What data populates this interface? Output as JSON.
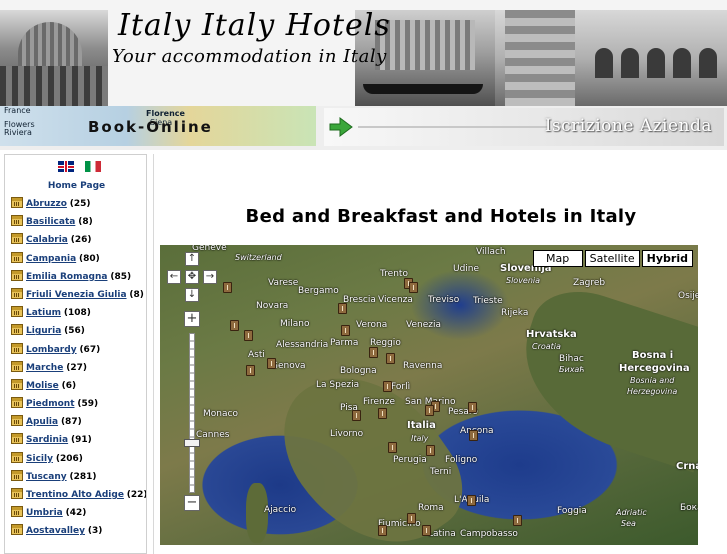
{
  "header": {
    "title": "Italy Italy Hotels",
    "subtitle": "Your accommodation in Italy"
  },
  "strip": {
    "book_online_label": "Book-Online",
    "book_online_places": [
      "France",
      "Florence",
      "Flowers",
      "Siena",
      "Riviera"
    ],
    "iscrizione_label": "Iscrizione Azienda"
  },
  "sidebar": {
    "home_label": "Home Page",
    "regions": [
      {
        "name": "Abruzzo",
        "count": "(25)"
      },
      {
        "name": "Basilicata",
        "count": "(8)"
      },
      {
        "name": "Calabria",
        "count": "(26)"
      },
      {
        "name": "Campania",
        "count": "(80)"
      },
      {
        "name": "Emilia Romagna",
        "count": "(85)"
      },
      {
        "name": "Friuli Venezia Giulia",
        "count": "(8)"
      },
      {
        "name": "Latium",
        "count": "(108)"
      },
      {
        "name": "Liguria",
        "count": "(56)"
      },
      {
        "name": "Lombardy",
        "count": "(67)"
      },
      {
        "name": "Marche",
        "count": "(27)"
      },
      {
        "name": "Molise",
        "count": "(6)"
      },
      {
        "name": "Piedmont",
        "count": "(59)"
      },
      {
        "name": "Apulia",
        "count": "(87)"
      },
      {
        "name": "Sardinia",
        "count": "(91)"
      },
      {
        "name": "Sicily",
        "count": "(206)"
      },
      {
        "name": "Tuscany",
        "count": "(281)"
      },
      {
        "name": "Trentino Alto Adige",
        "count": "(22)"
      },
      {
        "name": "Umbria",
        "count": "(42)"
      },
      {
        "name": "Aostavalley",
        "count": "(3)"
      }
    ]
  },
  "main": {
    "title": "Bed and Breakfast and Hotels in Italy"
  },
  "map": {
    "types": [
      "Map",
      "Satellite",
      "Hybrid"
    ],
    "active_type": "Hybrid",
    "controls": {
      "zoom_in": "+",
      "zoom_out": "−",
      "up": "↑",
      "down": "↓",
      "left": "←",
      "right": "→",
      "center": "✥"
    },
    "labels": [
      "Geneve",
      "Switzerland",
      "Villach",
      "Udine",
      "Slovenija",
      "Slovenia",
      "Zagreb",
      "Trento",
      "Varese",
      "Bergamo",
      "Brescia",
      "Vicenza",
      "Treviso",
      "Novara",
      "Trieste",
      "Rijeka",
      "Osijek",
      "Milano",
      "Verona",
      "Venezia",
      "Hrvatska",
      "Croatia",
      "Asti",
      "Alessandria",
      "Parma",
      "Reggio",
      "Bihac",
      "Бихаћ",
      "Genova",
      "Bologna",
      "Ravenna",
      "Bosna i",
      "Hercegovina",
      "Bosnia and",
      "Herzegovina",
      "La Spezia",
      "Forlì",
      "Monaco",
      "Pisa",
      "Firenze",
      "San Marino",
      "Livorno",
      "Pesaro",
      "Italia",
      "Italy",
      "Ancona",
      "Cannes",
      "Perugia",
      "Foligno",
      "Terni",
      "Crna",
      "Ajaccio",
      "L'Aquila",
      "Roma",
      "Foggia",
      "Adriatic",
      "Sea",
      "Fiumicino",
      "Latina",
      "Campobasso",
      "Бока"
    ],
    "accent_colors": {
      "water": "#24438f",
      "land": "#6b7a45"
    }
  }
}
